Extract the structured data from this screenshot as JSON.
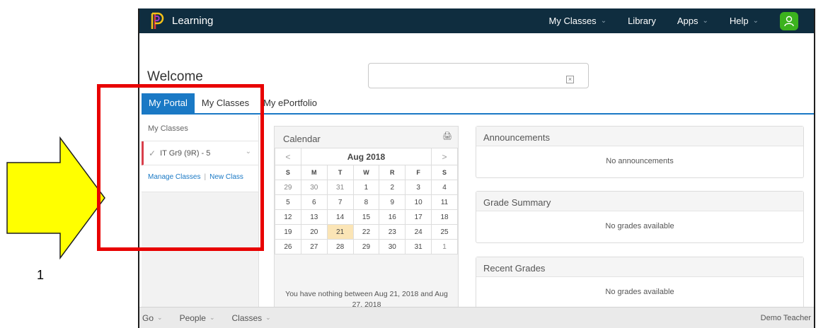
{
  "annotation": {
    "step_number": "1",
    "arrow_color": "#ffff00",
    "box_color": "#e80000"
  },
  "topbar": {
    "brand": "Learning",
    "nav": [
      {
        "label": "My Classes",
        "dropdown": true
      },
      {
        "label": "Library",
        "dropdown": false
      },
      {
        "label": "Apps",
        "dropdown": true
      },
      {
        "label": "Help",
        "dropdown": true
      }
    ],
    "avatar_icon": "user-icon",
    "colors": {
      "bar": "#0f2d3f",
      "avatar": "#3cb21e"
    }
  },
  "welcome": "Welcome",
  "search": {
    "value": "",
    "placeholder": ""
  },
  "tabs": [
    {
      "label": "My Portal",
      "active": true
    },
    {
      "label": "My Classes",
      "active": false
    },
    {
      "label": "My ePortfolio",
      "active": false
    }
  ],
  "portal": {
    "header": "My Classes",
    "class_item": "IT Gr9 (9R) - 5",
    "manage_link": "Manage Classes",
    "new_link": "New Class"
  },
  "calendar": {
    "title": "Calendar",
    "month": "Aug 2018",
    "prev": "<",
    "next": ">",
    "days_of_week": [
      "S",
      "M",
      "T",
      "W",
      "R",
      "F",
      "S"
    ],
    "weeks": [
      [
        "29",
        "30",
        "31",
        "1",
        "2",
        "3",
        "4"
      ],
      [
        "5",
        "6",
        "7",
        "8",
        "9",
        "10",
        "11"
      ],
      [
        "12",
        "13",
        "14",
        "15",
        "16",
        "17",
        "18"
      ],
      [
        "19",
        "20",
        "21",
        "22",
        "23",
        "24",
        "25"
      ],
      [
        "26",
        "27",
        "28",
        "29",
        "30",
        "31",
        "1"
      ]
    ],
    "today": "21",
    "empty_message": "You have nothing between Aug 21, 2018 and Aug 27, 2018"
  },
  "widgets": {
    "announcements": {
      "title": "Announcements",
      "body": "No announcements"
    },
    "grade_summary": {
      "title": "Grade Summary",
      "body": "No grades available"
    },
    "recent_grades": {
      "title": "Recent Grades",
      "body": "No grades available"
    }
  },
  "footer": {
    "items": [
      "Go",
      "People",
      "Classes"
    ],
    "user": "Demo Teacher"
  }
}
